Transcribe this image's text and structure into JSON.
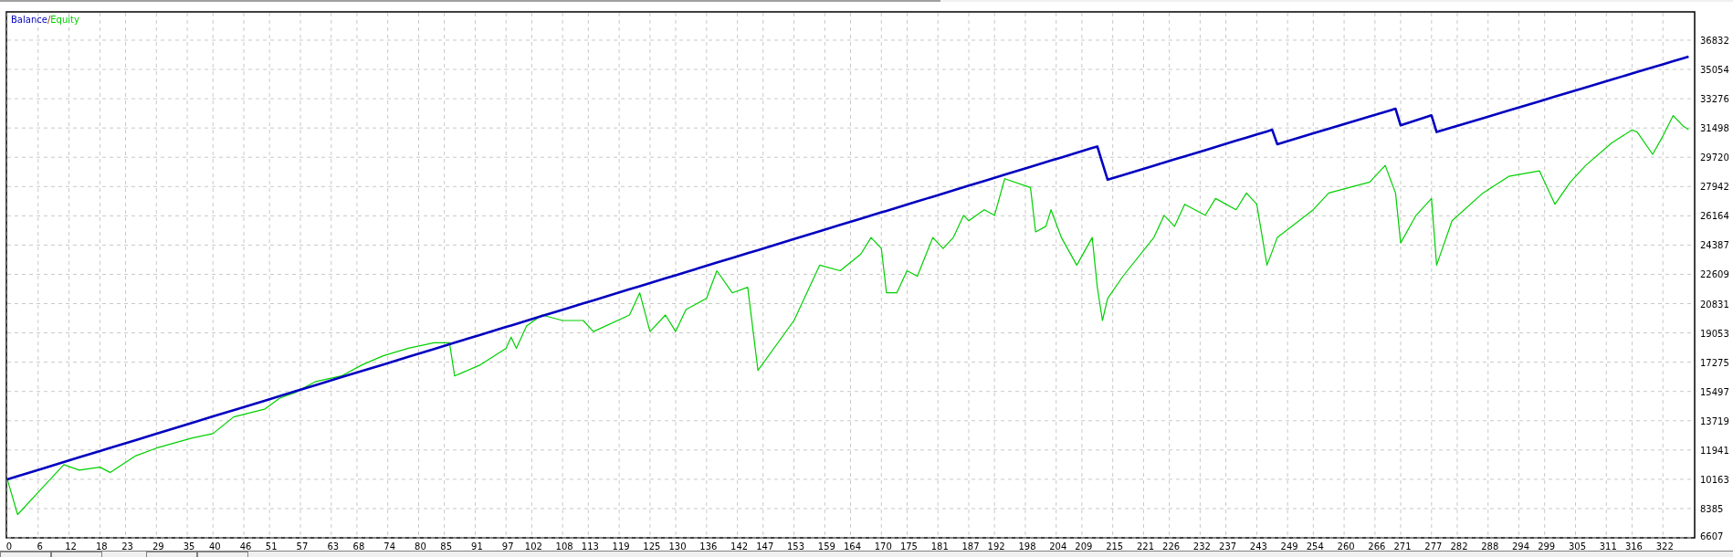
{
  "chart": {
    "legend_separator": "/",
    "chart_data": {
      "type": "line",
      "grid": true,
      "xlim": [
        0,
        328
      ],
      "ylim": [
        6607,
        38550
      ],
      "xticks": [
        0,
        6,
        12,
        18,
        23,
        29,
        35,
        40,
        46,
        51,
        57,
        63,
        68,
        74,
        80,
        85,
        91,
        97,
        102,
        108,
        113,
        119,
        125,
        130,
        136,
        142,
        147,
        153,
        159,
        164,
        170,
        175,
        181,
        187,
        192,
        198,
        204,
        209,
        215,
        221,
        226,
        232,
        237,
        243,
        249,
        254,
        260,
        266,
        271,
        277,
        282,
        288,
        294,
        299,
        305,
        311,
        316,
        322
      ],
      "yticks": [
        6607,
        8385,
        10163,
        11941,
        13719,
        15497,
        17275,
        19053,
        20831,
        22609,
        24387,
        26164,
        27942,
        29720,
        31498,
        33276,
        35054,
        36832
      ],
      "x": [
        0,
        2,
        7,
        11,
        14,
        18,
        20,
        25,
        29,
        36,
        40,
        44,
        50,
        53,
        56,
        60,
        65,
        69,
        73,
        78,
        83,
        86,
        87,
        92,
        97,
        98,
        99,
        101,
        104,
        108,
        112,
        114,
        121,
        123,
        125,
        128,
        130,
        132,
        136,
        138,
        141,
        144,
        146,
        153,
        158,
        162,
        166,
        168,
        170,
        171,
        173,
        175,
        177,
        180,
        182,
        184,
        186,
        187,
        190,
        192,
        194,
        199,
        200,
        202,
        203,
        205,
        208,
        211,
        212,
        213,
        214,
        217,
        223,
        225,
        227,
        229,
        233,
        235,
        239,
        241,
        243,
        245,
        246,
        247,
        254,
        257,
        261,
        265,
        268,
        270,
        271,
        274,
        277,
        278,
        281,
        287,
        292,
        298,
        301,
        304,
        307,
        312,
        316,
        317,
        320,
        322,
        324,
        326,
        327
      ],
      "series": [
        {
          "name": "Balance",
          "color": "#0000c0",
          "values": [
            10163,
            10354,
            10830,
            11212,
            11498,
            11879,
            12070,
            12547,
            12928,
            13596,
            13977,
            14358,
            14931,
            15217,
            15503,
            15884,
            16360,
            16742,
            17123,
            17600,
            18077,
            18363,
            18458,
            18935,
            19412,
            19507,
            19603,
            19793,
            20079,
            20461,
            20842,
            21033,
            21700,
            21891,
            22082,
            22367,
            22558,
            22749,
            23130,
            23321,
            23607,
            23893,
            24084,
            24752,
            25228,
            25610,
            25991,
            26182,
            26373,
            26468,
            26659,
            26849,
            27040,
            27326,
            27517,
            27707,
            27898,
            27994,
            28280,
            28470,
            28661,
            29138,
            29233,
            29424,
            29520,
            29710,
            29996,
            30282,
            30378,
            29368,
            28357,
            28641,
            29209,
            29399,
            29588,
            29778,
            30156,
            30346,
            30725,
            30914,
            31104,
            31293,
            31388,
            30513,
            31169,
            31450,
            31825,
            32200,
            32481,
            32667,
            31657,
            31960,
            32264,
            31253,
            31534,
            32095,
            32562,
            33123,
            33404,
            33684,
            33965,
            34432,
            34806,
            34900,
            35180,
            35367,
            35554,
            35741,
            35833
          ]
        },
        {
          "name": "Equity",
          "color": "#00d000",
          "values": [
            10163,
            8019,
            9705,
            11050,
            10714,
            10900,
            10580,
            11590,
            12060,
            12668,
            12937,
            13947,
            14418,
            15090,
            15428,
            16100,
            16439,
            17112,
            17650,
            18122,
            18459,
            18459,
            16439,
            17112,
            18122,
            18795,
            18122,
            19468,
            20140,
            19804,
            19804,
            19132,
            20140,
            21486,
            19132,
            20140,
            19132,
            20470,
            21150,
            22830,
            21486,
            21822,
            16775,
            19804,
            23167,
            22830,
            23840,
            24849,
            24177,
            21486,
            21486,
            22830,
            22494,
            24849,
            24177,
            24849,
            26195,
            25860,
            26531,
            26195,
            28419,
            27881,
            25187,
            25524,
            26531,
            24849,
            23167,
            24849,
            21822,
            19804,
            21150,
            22494,
            24849,
            26195,
            25524,
            26868,
            26195,
            27212,
            26531,
            27549,
            26868,
            23167,
            24000,
            24849,
            26531,
            27549,
            27881,
            28219,
            29228,
            27549,
            24513,
            26195,
            27212,
            23167,
            25860,
            27549,
            28556,
            28891,
            26868,
            28219,
            29228,
            30574,
            31382,
            31250,
            29900,
            31000,
            32250,
            31600,
            31400
          ]
        }
      ]
    }
  }
}
